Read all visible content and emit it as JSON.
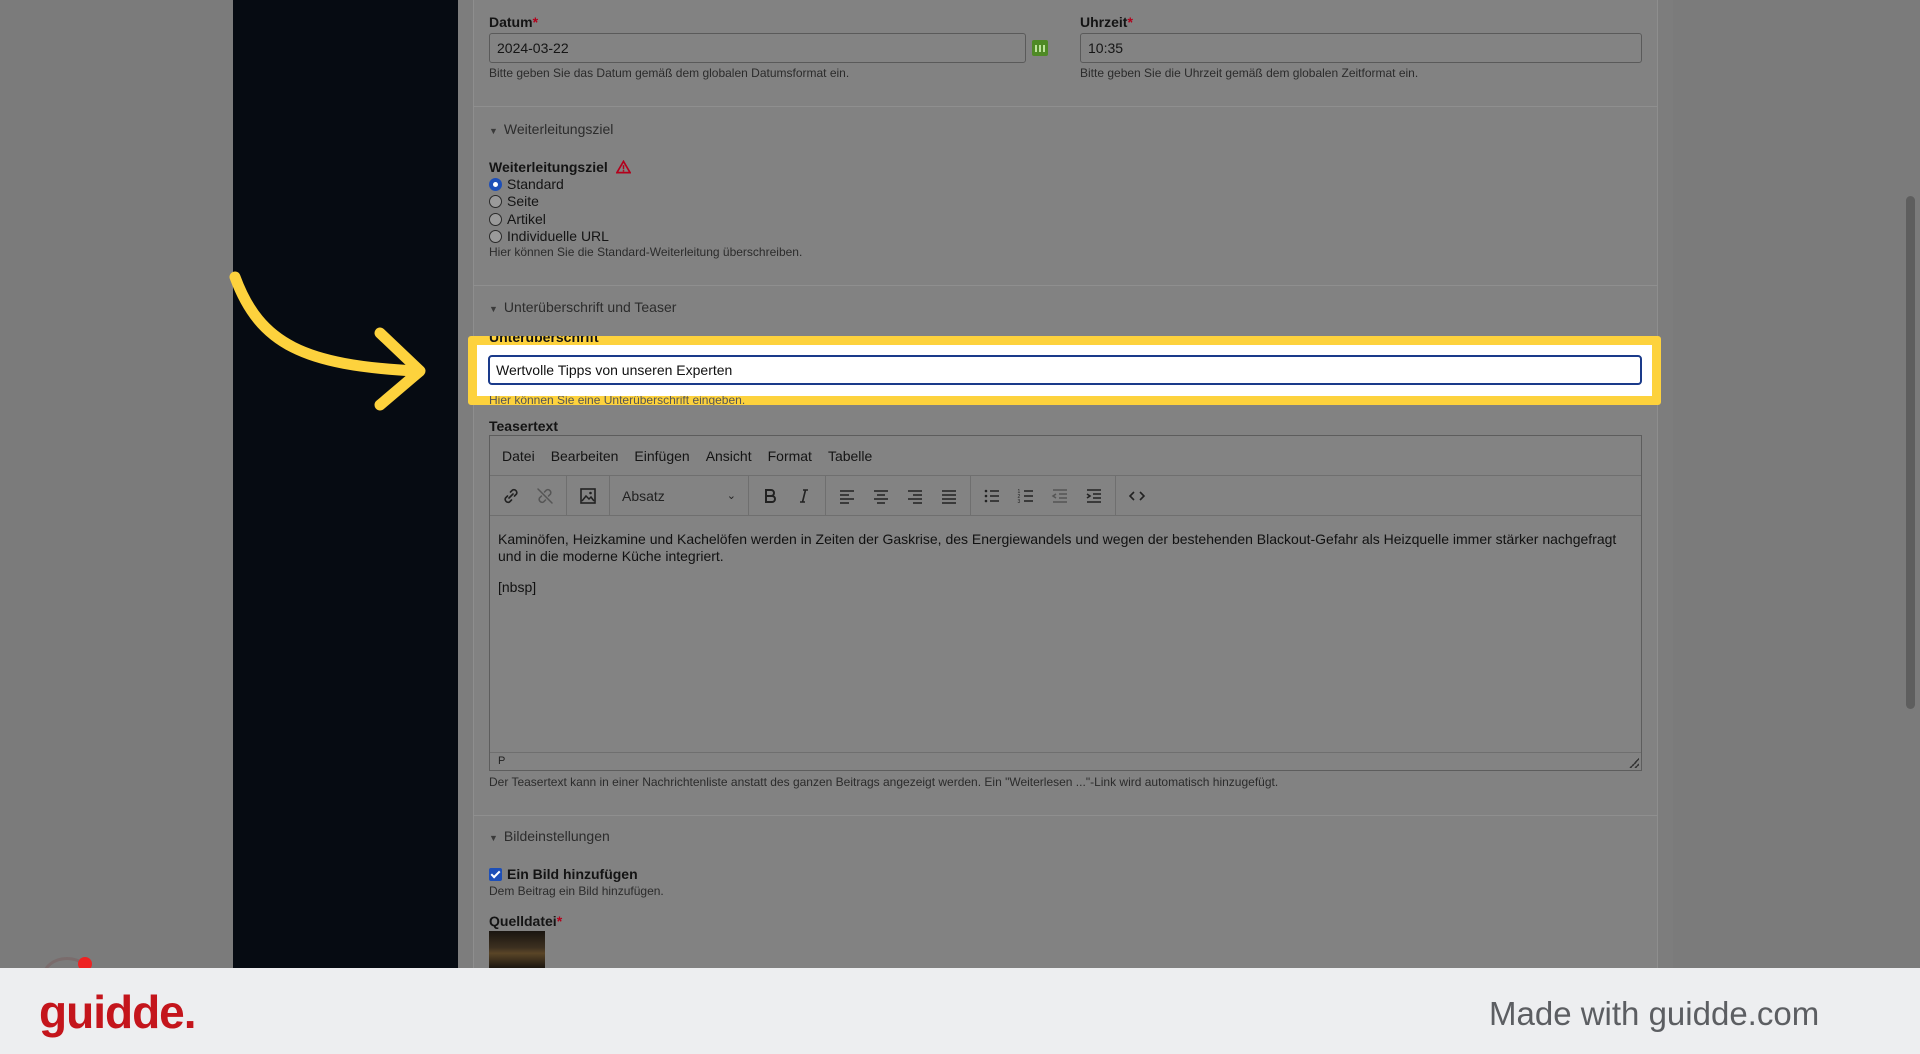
{
  "form": {
    "date": {
      "label": "Datum",
      "required_mark": "*",
      "value": "2024-03-22",
      "help": "Bitte geben Sie das Datum gemäß dem globalen Datumsformat ein."
    },
    "time": {
      "label": "Uhrzeit",
      "required_mark": "*",
      "value": "10:35",
      "help": "Bitte geben Sie die Uhrzeit gemäß dem globalen Zeitformat ein."
    },
    "redirect_section": {
      "legend": "Weiterleitungsziel",
      "label": "Weiterleitungsziel",
      "options": [
        "Standard",
        "Seite",
        "Artikel",
        "Individuelle URL"
      ],
      "selected": "Standard",
      "help": "Hier können Sie die Standard-Weiterleitung überschreiben."
    },
    "teaser_section": {
      "legend": "Unterüberschrift und Teaser",
      "subheadline": {
        "label": "Unterüberschrift",
        "value": "Wertvolle Tipps von unseren Experten",
        "help": "Hier können Sie eine Unterüberschrift eingeben."
      },
      "teaser": {
        "label": "Teasertext",
        "menu": [
          "Datei",
          "Bearbeiten",
          "Einfügen",
          "Ansicht",
          "Format",
          "Tabelle"
        ],
        "block_format": "Absatz",
        "body_paragraph": "Kaminöfen, Heizkamine und Kachelöfen werden in Zeiten der Gaskrise, des Energiewandels und wegen der bestehenden Blackout-Gefahr als Heizquelle immer stärker nachgefragt und in die moderne Küche integriert.",
        "body_nbsp": "[nbsp]",
        "status_path": "P",
        "help": "Der Teasertext kann in einer Nachrichtenliste anstatt des ganzen Beitrags angezeigt werden. Ein \"Weiterlesen ...\"-Link wird automatisch hinzugefügt."
      }
    },
    "image_section": {
      "legend": "Bildeinstellungen",
      "add_image": {
        "label": "Ein Bild hinzufügen",
        "checked": true,
        "help": "Dem Beitrag ein Bild hinzufügen."
      },
      "source": {
        "label": "Quelldatei",
        "required_mark": "*"
      }
    }
  },
  "footer": {
    "logo": "guidde.",
    "made_with": "Made with guidde.com"
  },
  "colors": {
    "highlight": "#fdd23d",
    "brand": "#c4151c",
    "arrow": "#fdd23d"
  }
}
